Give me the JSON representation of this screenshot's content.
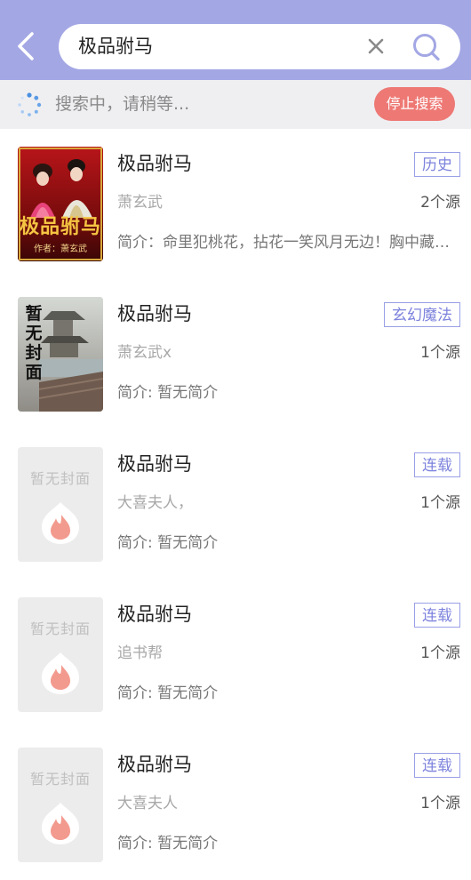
{
  "header": {
    "search_query": "极品驸马"
  },
  "status": {
    "text": "搜索中，请稍等...",
    "stop_label": "停止搜索"
  },
  "colors": {
    "header_bg": "#a3a7e4",
    "accent": "#7d83dd",
    "stop_button": "#ee7874"
  },
  "placeholder_cover_text": "暂无封面",
  "results": [
    {
      "title": "极品驸马",
      "tag": "历史",
      "author": "萧玄武",
      "sources": "2个源",
      "intro": "简介：命里犯桃花，拈花一笑风月无边！胸中藏丘壑，谈笑间风起云涌！",
      "cover_text_main": "极品驸马",
      "cover_text_sub": "作者：萧玄武"
    },
    {
      "title": "极品驸马",
      "tag": "玄幻魔法",
      "author": "萧玄武x",
      "sources": "1个源",
      "intro": "简介: 暂无简介",
      "cover_text_main": "暂无封面"
    },
    {
      "title": "极品驸马",
      "tag": "连载",
      "author": "大喜夫人，",
      "sources": "1个源",
      "intro": "简介: 暂无简介"
    },
    {
      "title": "极品驸马",
      "tag": "连载",
      "author": "追书帮",
      "sources": "1个源",
      "intro": "简介: 暂无简介"
    },
    {
      "title": "极品驸马",
      "tag": "连载",
      "author": "大喜夫人",
      "sources": "1个源",
      "intro": "简介: 暂无简介"
    }
  ]
}
